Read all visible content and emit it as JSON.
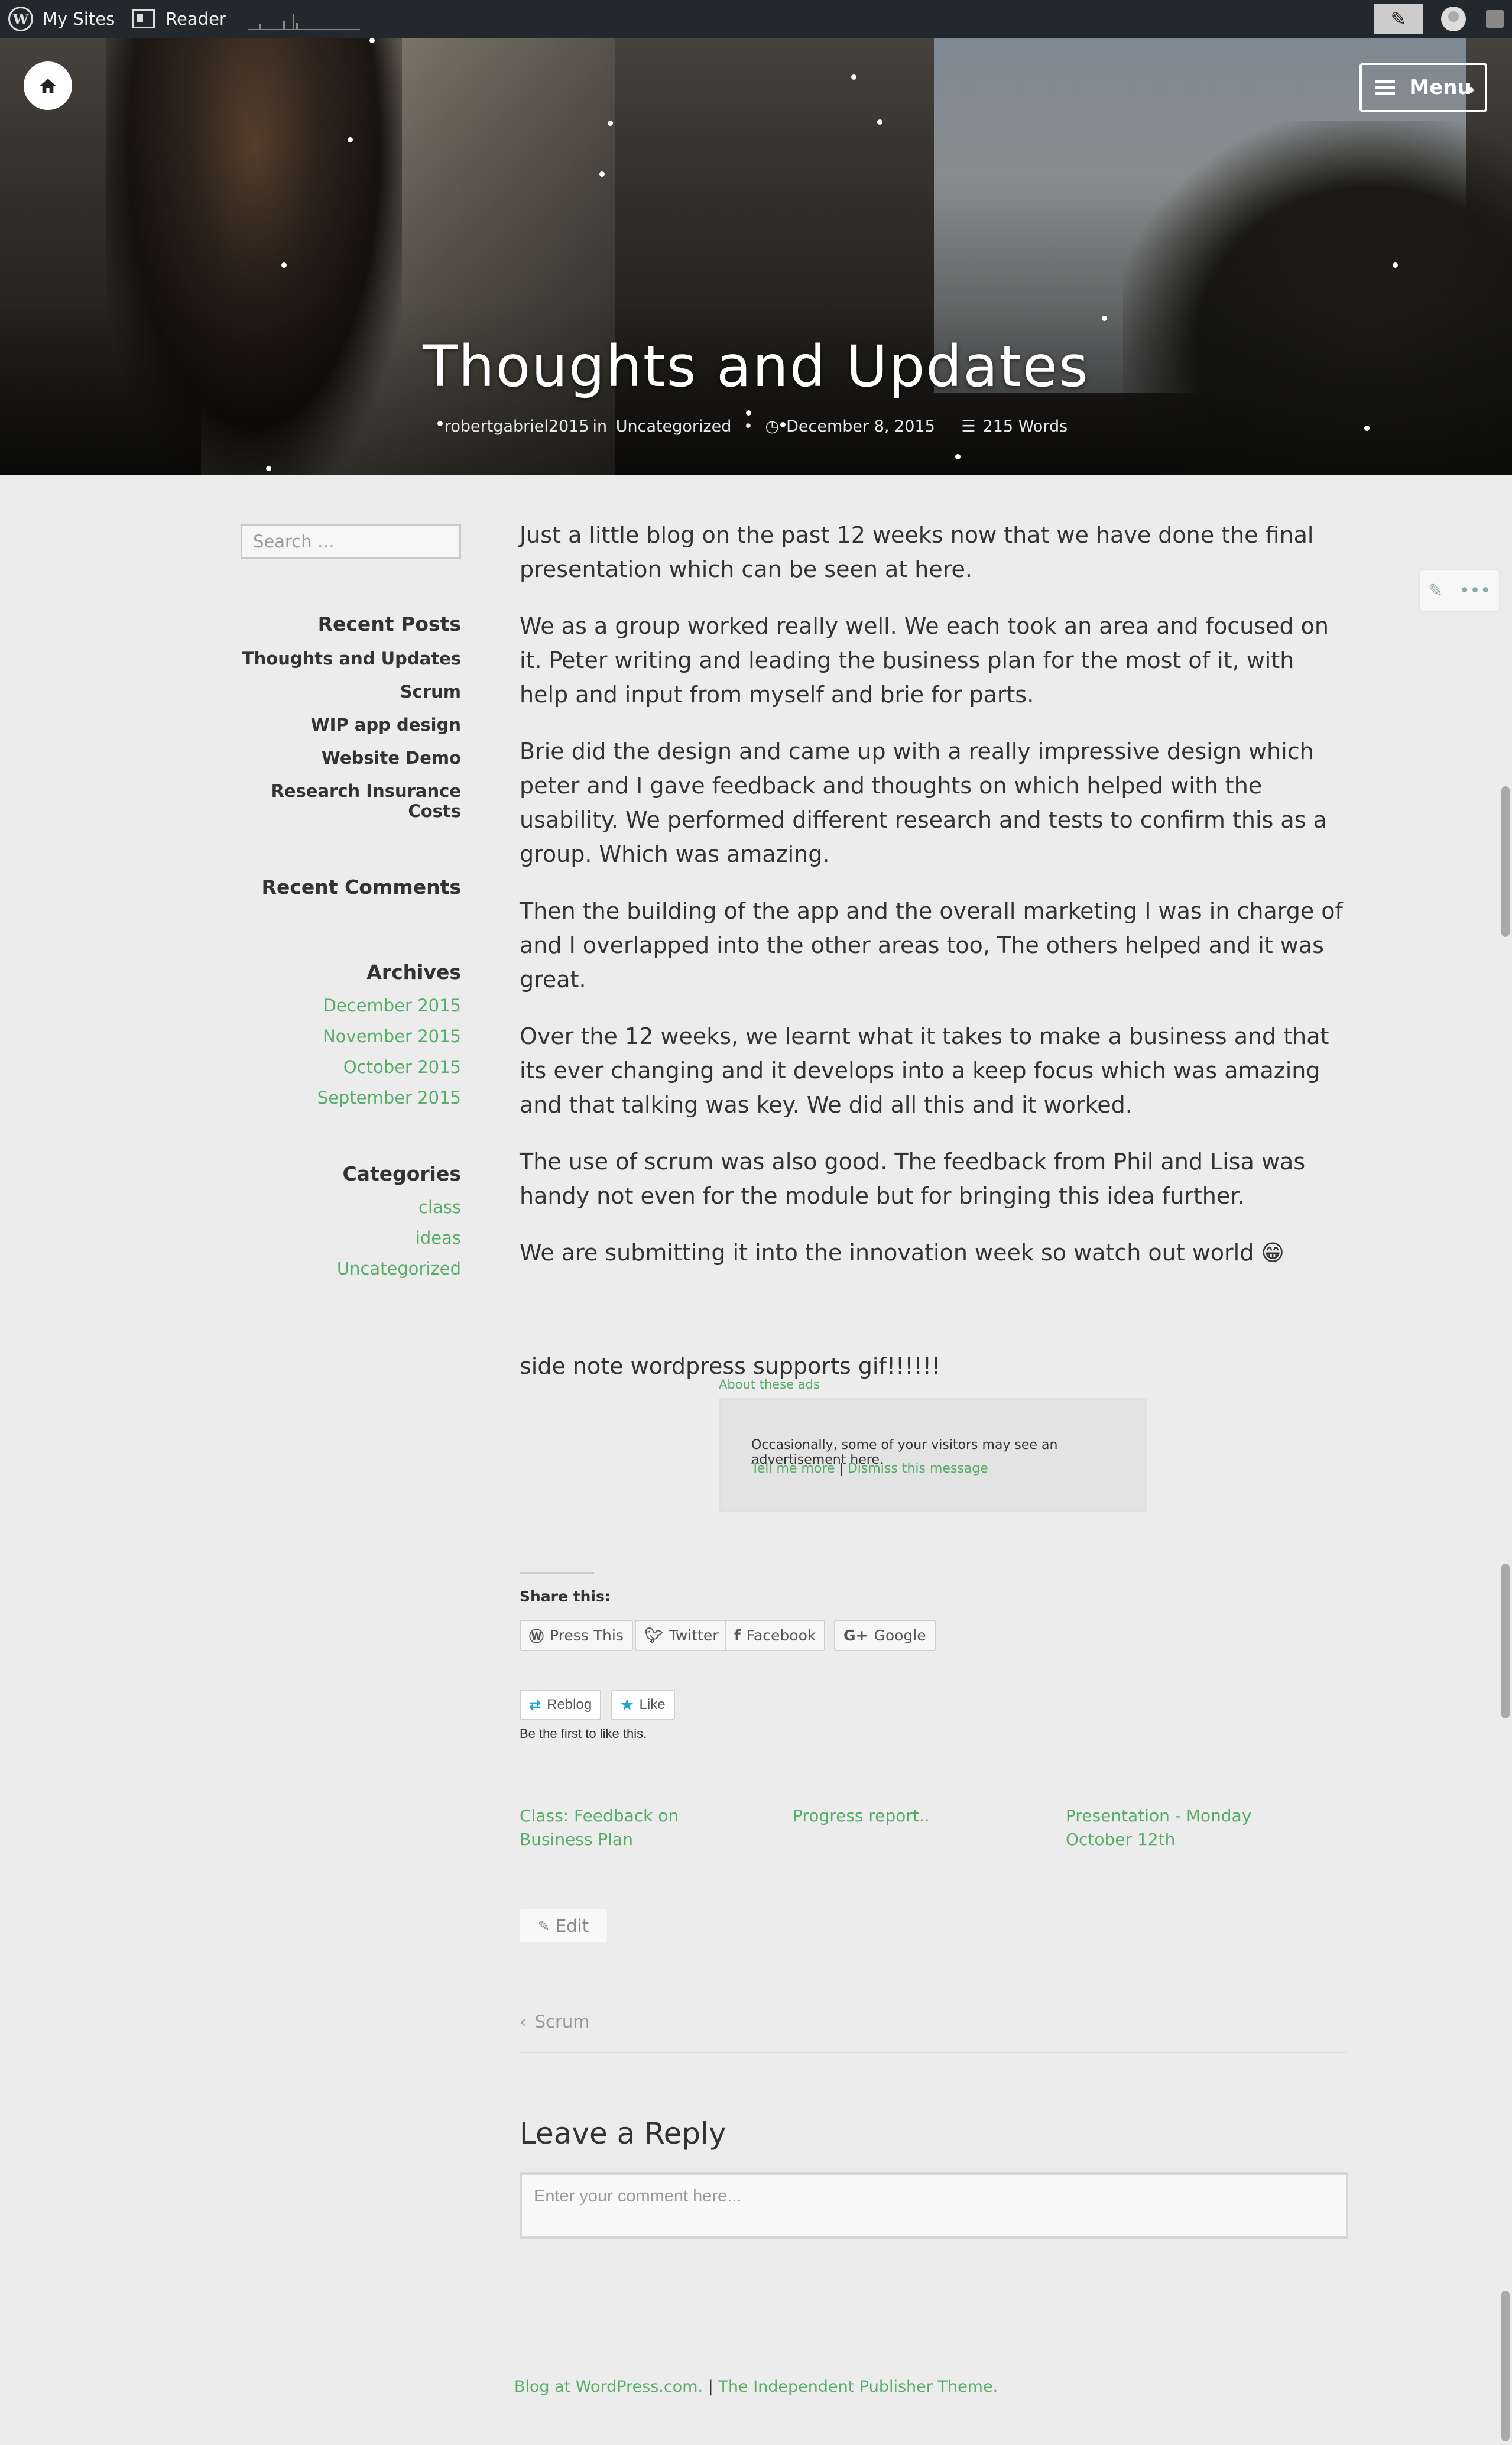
{
  "admin_bar": {
    "my_sites": "My Sites",
    "reader": "Reader"
  },
  "hero": {
    "title": "Thoughts and Updates",
    "author": "robertgabriel2015",
    "in": "in",
    "category": "Uncategorized",
    "date": "December 8, 2015",
    "words": "215 Words",
    "menu_label": "Menu"
  },
  "sidebar": {
    "search_placeholder": "Search …",
    "recent_posts_title": "Recent Posts",
    "recent_posts": [
      "Thoughts and Updates",
      "Scrum",
      "WIP app design",
      "Website Demo",
      "Research Insurance Costs"
    ],
    "recent_comments_title": "Recent Comments",
    "archives_title": "Archives",
    "archives": [
      "December 2015",
      "November 2015",
      "October 2015",
      "September 2015"
    ],
    "categories_title": "Categories",
    "categories": [
      "class",
      "ideas",
      "Uncategorized"
    ]
  },
  "post": {
    "paragraphs": [
      "Just a little blog on the past 12 weeks now that we have done the final presentation which can be seen at here.",
      "We as a group worked really well. We each took an area and focused on it. Peter writing and leading the business plan for the most of it, with help and input from myself and brie for parts.",
      "Brie did the design and came up with a really impressive design which peter and I gave feedback and thoughts on which helped with the usability. We performed different research and tests to confirm this as a group. Which was amazing.",
      "Then the building of the app and the overall marketing I was in charge of and I overlapped into the other areas too, The others helped and it was great.",
      "Over the 12 weeks, we learnt what it takes to make a business and that its ever changing and it develops into a keep focus which was amazing and that talking was key. We did all this and it worked.",
      "The use of scrum was also good. The feedback from Phil and Lisa was handy not even for the module but for bringing this idea further.",
      "We are submitting it into the innovation week so watch out world 😁"
    ],
    "side_note": "side note wordpress supports gif!!!!!!"
  },
  "ads": {
    "label": "About these ads",
    "text": "Occasionally, some of your visitors may see an advertisement here.",
    "tell_more": "Tell me more",
    "separator": "|",
    "dismiss": "Dismiss this message"
  },
  "share": {
    "title": "Share this:",
    "buttons": [
      "Press This",
      "Twitter",
      "Facebook",
      "Google"
    ]
  },
  "likes": {
    "reblog": "Reblog",
    "like": "Like",
    "first": "Be the first to like this."
  },
  "related": [
    "Class: Feedback on Business Plan",
    "Progress report..",
    "Presentation - Monday October 12th"
  ],
  "edit_label": "Edit",
  "prev_post": "Scrum",
  "reply": {
    "title": "Leave a Reply",
    "placeholder": "Enter your comment here..."
  },
  "footer": {
    "blog": "Blog at WordPress.com.",
    "sep": "|",
    "theme": "The Independent Publisher Theme."
  },
  "colors": {
    "accent": "#57ad68",
    "admin_bar": "#23282d",
    "page_bg": "#ececec"
  }
}
